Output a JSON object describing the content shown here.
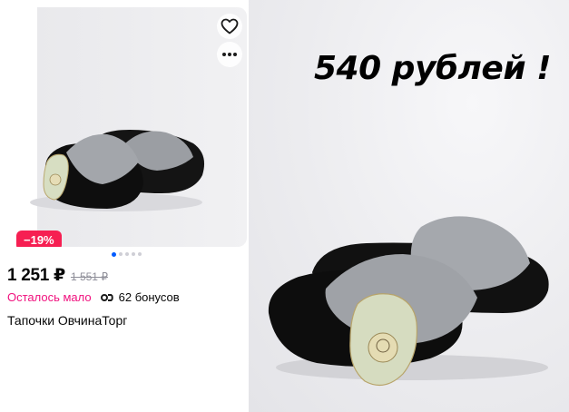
{
  "card": {
    "discount_badge": "−19%",
    "price": "1 251 ₽",
    "old_price": "1 551 ₽",
    "stock_status": "Осталось мало",
    "bonus": "62 бонусов",
    "title": "Тапочки ОвчинаТорг",
    "carousel": {
      "count": 5,
      "active": 0
    },
    "icons": {
      "favorite": "heart-outline-icon",
      "more": "more-dots-icon",
      "bonus": "bonus-infinity-icon"
    },
    "colors": {
      "badge": "#f61f52",
      "stock": "#f1117e",
      "dot_active": "#005bff"
    }
  },
  "promo": {
    "price_text": "540 рублей !"
  }
}
